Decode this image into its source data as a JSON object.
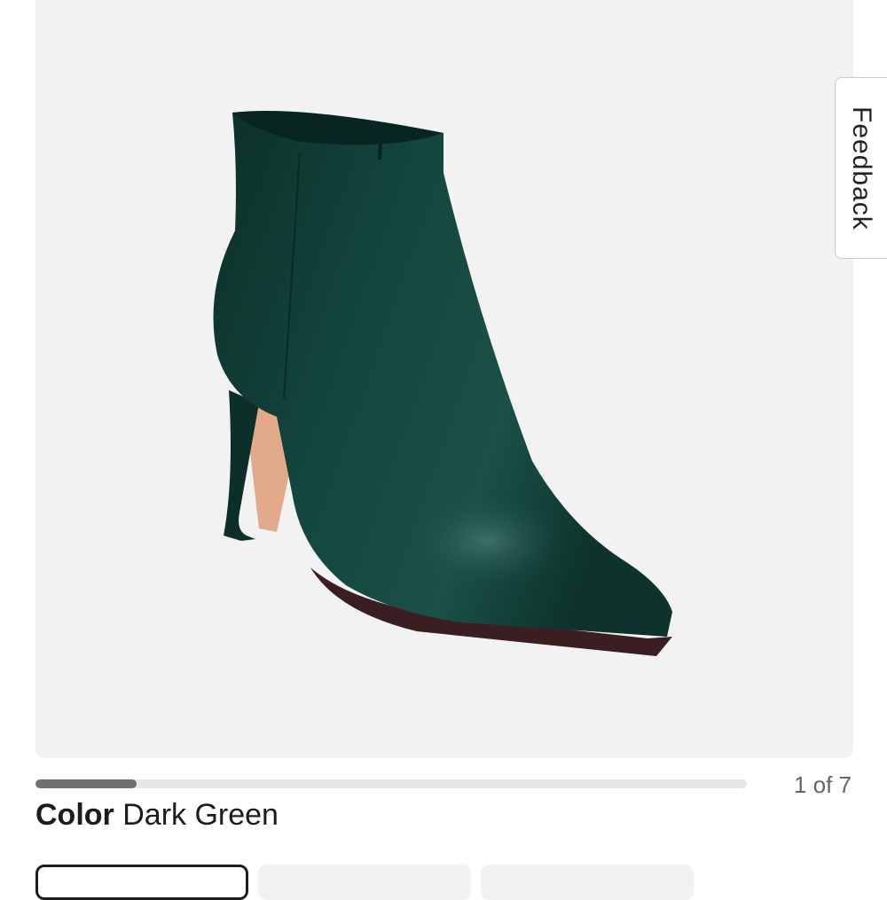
{
  "product_image": {
    "alt": "Dark green leather square-toe ankle boot with flared heel",
    "boot_color": "#0f3b33",
    "sole_color": "#3a1e22",
    "heel_lining_color": "#e2a98a",
    "background_color": "#f2f2f2"
  },
  "feedback": {
    "label": "Feedback"
  },
  "carousel": {
    "current": 1,
    "total": 7,
    "counter_text": "1 of 7",
    "progress_fraction": 0.142
  },
  "color": {
    "label": "Color",
    "value": "Dark Green"
  },
  "swatches": [
    {
      "name": "swatch-1",
      "selected": true
    },
    {
      "name": "swatch-2",
      "selected": false
    },
    {
      "name": "swatch-3",
      "selected": false
    }
  ]
}
